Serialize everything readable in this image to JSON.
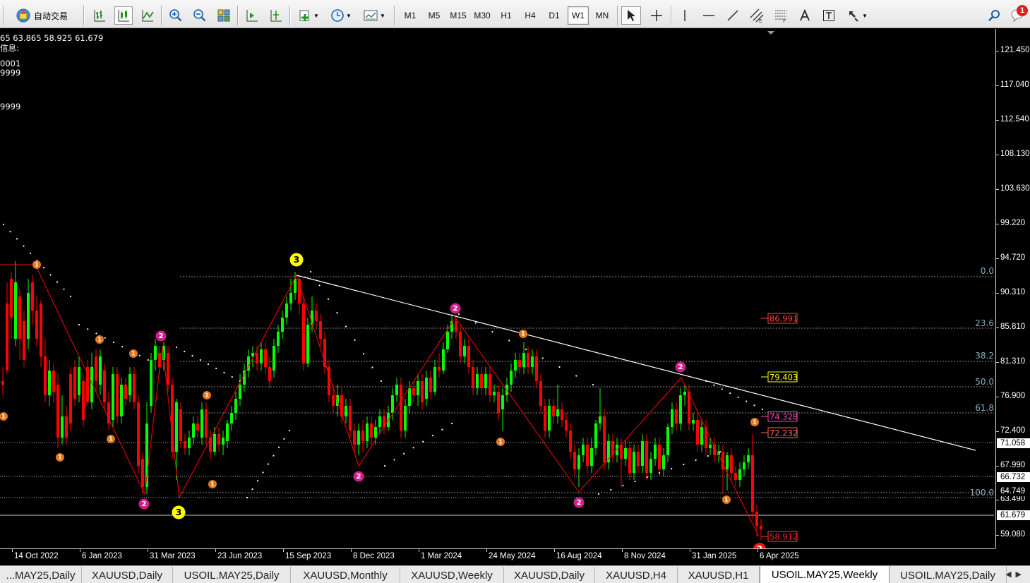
{
  "toolbar": {
    "auto_trade_label": "自动交易",
    "timeframes": [
      "M1",
      "M5",
      "M15",
      "M30",
      "H1",
      "H4",
      "D1",
      "W1",
      "MN"
    ],
    "active_timeframe": "W1",
    "notification_count": "1"
  },
  "chart": {
    "info_lines": [
      "65 63.865 58.925 61.679",
      "信息:",
      "0001",
      "9999",
      "9999"
    ],
    "price_ticks": [
      "121.450",
      "117.040",
      "112.540",
      "108.130",
      "103.630",
      "99.220",
      "94.720",
      "90.310",
      "85.810",
      "81.310",
      "76.900",
      "72.400",
      "67.990",
      "63.490",
      "59.080"
    ],
    "price_markers": [
      "71.058",
      "66.732",
      "64.749",
      "61.679"
    ],
    "date_ticks": [
      "14 Oct 2022",
      "6 Jan 2023",
      "31 Mar 2023",
      "23 Jun 2023",
      "15 Sep 2023",
      "8 Dec 2023",
      "1 Mar 2024",
      "24 May 2024",
      "16 Aug 2024",
      "8 Nov 2024",
      "31 Jan 2025",
      "6 Apr 2025"
    ],
    "fib_levels": [
      "0.0",
      "23.6",
      "38.2",
      "50.0",
      "61.8",
      "100.0"
    ],
    "level_labels": [
      "86.991",
      "79.403",
      "74.328",
      "72.232",
      "58.912"
    ],
    "wave_labels": [
      "1",
      "2",
      "3"
    ],
    "colors": {
      "background": "#000000",
      "bull": "#00ff00",
      "bear": "#ff0000",
      "zigzag": "#ff0000",
      "trendline": "#ffffff",
      "wave1": "#e07820",
      "wave2": "#d0208c",
      "wave3": "#ffff00"
    }
  },
  "tabs": [
    "...MAY25,Daily",
    "XAUUSD,Daily",
    "USOIL.MAY25,Daily",
    "XAUUSD,Monthly",
    "XAUUSD,Weekly",
    "XAUUSD,Daily",
    "XAUUSD,H4",
    "XAUUSD,H1",
    "USOIL.MAY25,Weekly",
    "USOIL.MAY25,Daily"
  ],
  "active_tab": "USOIL.MAY25,Weekly"
}
